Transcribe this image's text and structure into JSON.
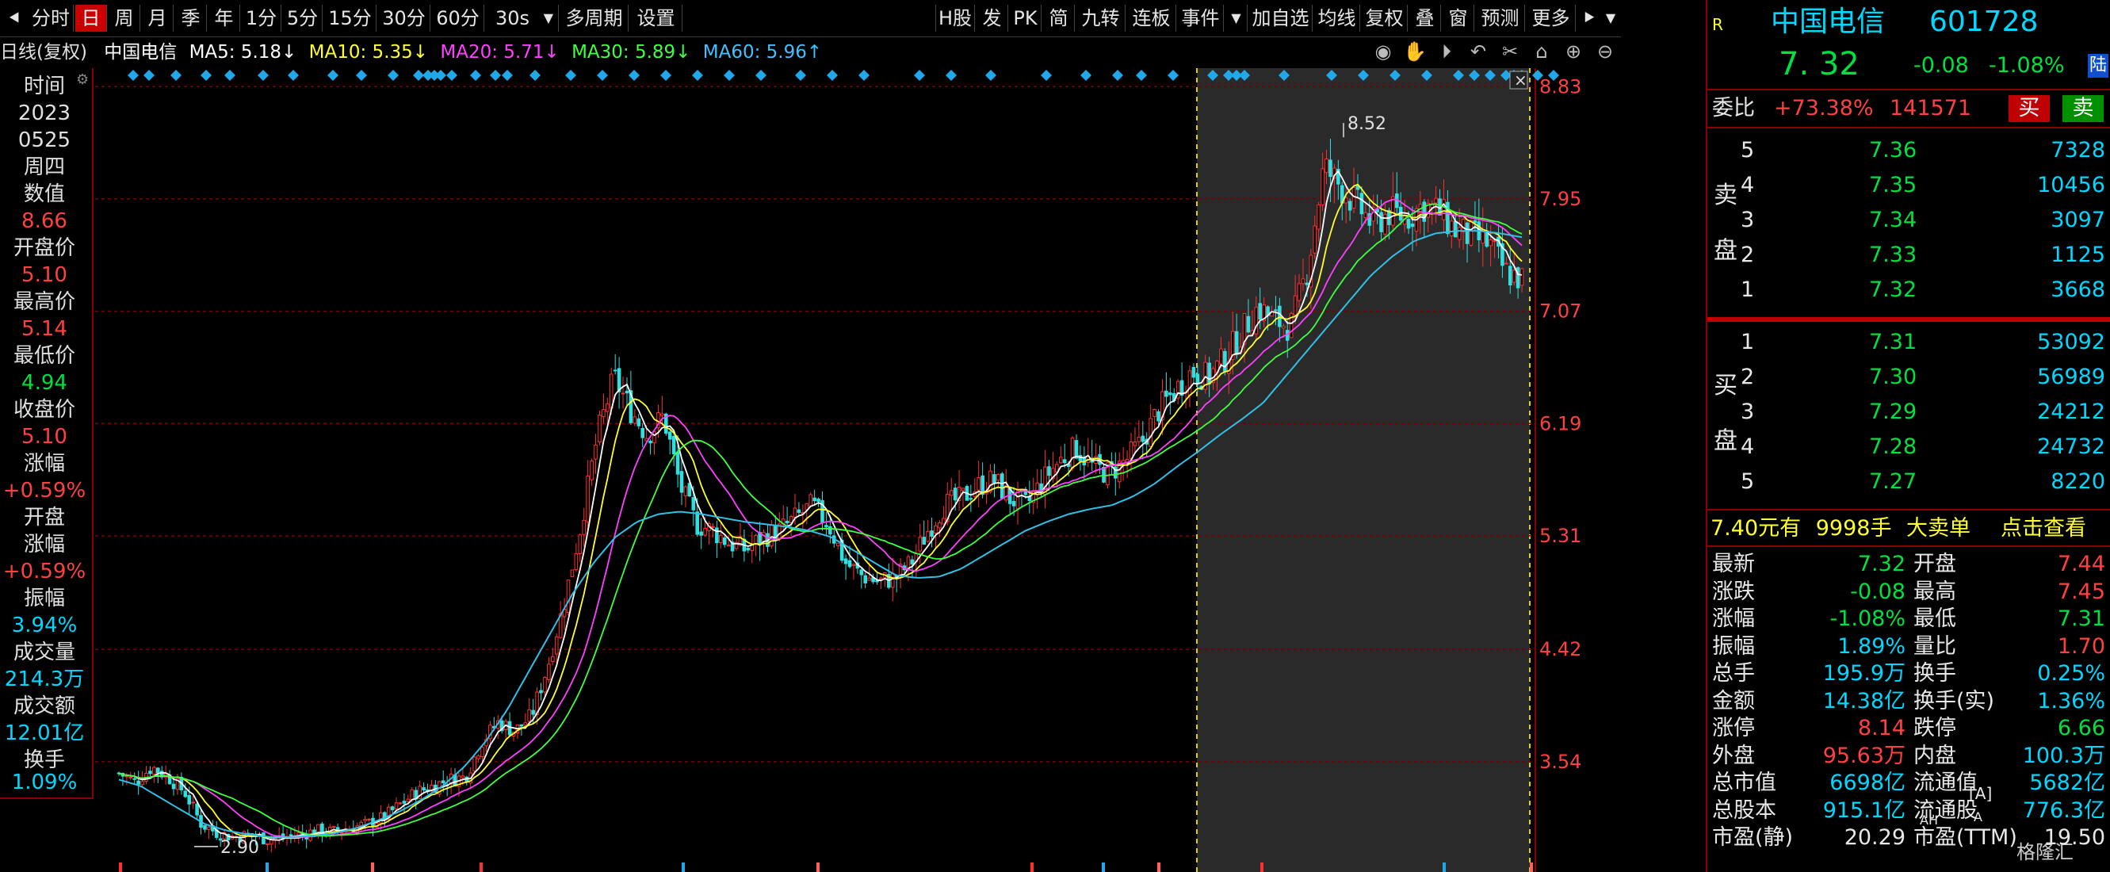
{
  "toolbar": {
    "left": [
      "分时",
      "日",
      "周",
      "月",
      "季",
      "年",
      "1分",
      "5分",
      "15分",
      "30分",
      "60分",
      "30s",
      "多周期",
      "设置"
    ],
    "right": [
      "H股",
      "发",
      "PK",
      "简",
      "九转",
      "连板",
      "事件",
      "加自选",
      "均线",
      "复权",
      "叠",
      "窗",
      "预测",
      "更多"
    ]
  },
  "ma_line": {
    "period": "日线(复权)",
    "name": "中国电信",
    "ma5": "MA5: 5.18↓",
    "ma10": "MA10: 5.35↓",
    "ma20": "MA20: 5.71↓",
    "ma30": "MA30: 5.89↓",
    "ma60": "MA60: 5.96↑"
  },
  "left_panel": [
    {
      "label": "时间",
      "value": "2023",
      "value2": "0525",
      "value3": "周四"
    },
    {
      "label": "数值",
      "value": "8.66"
    },
    {
      "label": "开盘价",
      "value": "5.10"
    },
    {
      "label": "最高价",
      "value": "5.14"
    },
    {
      "label": "最低价",
      "value": "4.94"
    },
    {
      "label": "收盘价",
      "value": "5.10"
    },
    {
      "label": "涨幅",
      "value": "+0.59%"
    },
    {
      "label": "开盘涨幅",
      "value": "+0.59%"
    },
    {
      "label": "振幅",
      "value": "3.94%"
    },
    {
      "label": "成交量",
      "value": "214.3万"
    },
    {
      "label": "成交额",
      "value": "12.01亿"
    },
    {
      "label": "换手",
      "value": "1.09%"
    }
  ],
  "lp_labels": {
    "time": "时间",
    "year": "2023",
    "date": "0525",
    "weekday": "周四",
    "val_label": "数值",
    "val": "8.66",
    "open_label": "开盘价",
    "open": "5.10",
    "high_label": "最高价",
    "high": "5.14",
    "low_label": "最低价",
    "low": "4.94",
    "close_label": "收盘价",
    "close": "5.10",
    "chg_label": "涨幅",
    "chg": "+0.59%",
    "ochg_label1": "开盘",
    "ochg_label2": "涨幅",
    "ochg": "+0.59%",
    "amp_label": "振幅",
    "amp": "3.94%",
    "vol_label": "成交量",
    "vol": "214.3万",
    "amt_label": "成交额",
    "amt": "12.01亿",
    "turn_label": "换手",
    "turn": "1.09%"
  },
  "chart_data": {
    "type": "line",
    "title": "中国电信 日线(复权)",
    "ylim": [
      2.8,
      8.9
    ],
    "yticks": [
      8.83,
      7.95,
      7.07,
      6.19,
      5.31,
      4.42,
      3.54
    ],
    "high_label": "8.52",
    "low_label": "2.90",
    "series": [
      {
        "name": "K线",
        "values": [
          3.45,
          3.38,
          3.5,
          3.42,
          3.3,
          3.05,
          2.98,
          2.95,
          2.97,
          2.93,
          2.95,
          2.97,
          3.0,
          2.99,
          3.02,
          3.05,
          3.1,
          3.2,
          3.3,
          3.35,
          3.4,
          3.42,
          3.7,
          3.85,
          3.78,
          3.9,
          4.3,
          4.8,
          5.4,
          6.1,
          6.55,
          6.3,
          6.1,
          6.25,
          5.7,
          5.4,
          5.35,
          5.25,
          5.2,
          5.3,
          5.35,
          5.45,
          5.55,
          5.4,
          5.1,
          5.0,
          4.95,
          4.98,
          5.1,
          5.35,
          5.55,
          5.6,
          5.7,
          5.75,
          5.6,
          5.55,
          5.75,
          5.9,
          6.0,
          5.85,
          5.8,
          5.9,
          6.05,
          6.3,
          6.45,
          6.6,
          6.55,
          6.7,
          6.9,
          7.1,
          7.0,
          6.95,
          7.4,
          8.2,
          8.05,
          7.9,
          7.75,
          7.85,
          7.8,
          7.9,
          7.85,
          7.7,
          7.65,
          7.6,
          7.38,
          7.32
        ]
      },
      {
        "name": "MA60",
        "values": [
          3.4,
          3.35,
          3.25,
          3.15,
          3.05,
          3.0,
          2.97,
          2.95,
          2.95,
          2.96,
          2.98,
          3.02,
          3.08,
          3.15,
          3.24,
          3.35,
          3.5,
          3.7,
          3.95,
          4.25,
          4.55,
          4.85,
          5.1,
          5.3,
          5.42,
          5.48,
          5.5,
          5.48,
          5.45,
          5.42,
          5.4,
          5.38,
          5.35,
          5.3,
          5.2,
          5.1,
          5.0,
          4.98,
          4.99,
          5.05,
          5.15,
          5.25,
          5.35,
          5.42,
          5.48,
          5.52,
          5.55,
          5.62,
          5.72,
          5.85,
          5.97,
          6.1,
          6.22,
          6.35,
          6.55,
          6.75,
          6.95,
          7.15,
          7.35,
          7.5,
          7.62,
          7.68,
          7.7,
          7.7,
          7.68,
          7.65
        ]
      }
    ],
    "highlight_zone": true
  },
  "right_panel": {
    "badge": "R",
    "name": "中国电信",
    "code": "601728",
    "price": "7. 32",
    "change": "-0.08",
    "pct": "-1.08%",
    "lu": "陆",
    "weibi_label": "委比",
    "weibi": "+73.38%",
    "weicha": "141571",
    "buy_btn": "买",
    "sell_btn": "卖",
    "sell_label1": "卖",
    "sell_label2": "盘",
    "buy_label1": "买",
    "buy_label2": "盘",
    "asks": [
      {
        "lvl": "5",
        "price": "7.36",
        "vol": "7328"
      },
      {
        "lvl": "4",
        "price": "7.35",
        "vol": "10456"
      },
      {
        "lvl": "3",
        "price": "7.34",
        "vol": "3097"
      },
      {
        "lvl": "2",
        "price": "7.33",
        "vol": "1125"
      },
      {
        "lvl": "1",
        "price": "7.32",
        "vol": "3668"
      }
    ],
    "bids": [
      {
        "lvl": "1",
        "price": "7.31",
        "vol": "53092"
      },
      {
        "lvl": "2",
        "price": "7.30",
        "vol": "56989"
      },
      {
        "lvl": "3",
        "price": "7.29",
        "vol": "24212"
      },
      {
        "lvl": "4",
        "price": "7.28",
        "vol": "24732"
      },
      {
        "lvl": "5",
        "price": "7.27",
        "vol": "8220"
      }
    ],
    "bigorder_price": "7.40",
    "bigorder_text1": "元有",
    "bigorder_vol": "9998",
    "bigorder_text2": "手",
    "bigorder_text3": "大卖单",
    "bigorder_link": "点击查看",
    "stats": [
      {
        "l1": "最新",
        "v1": "7.32",
        "l2": "开盘",
        "v2": "7.44"
      },
      {
        "l1": "涨跌",
        "v1": "-0.08",
        "l2": "最高",
        "v2": "7.45"
      },
      {
        "l1": "涨幅",
        "v1": "-1.08%",
        "l2": "最低",
        "v2": "7.31"
      },
      {
        "l1": "振幅",
        "v1": "1.89%",
        "l2": "量比",
        "v2": "1.70"
      },
      {
        "l1": "总手",
        "v1": "195.9万",
        "l2": "换手",
        "v2": "0.25%"
      },
      {
        "l1": "金额",
        "v1": "14.38亿",
        "l2": "换手(实)",
        "v2": "1.36%"
      },
      {
        "l1": "涨停",
        "v1": "8.14",
        "l2": "跌停",
        "v2": "6.66"
      },
      {
        "l1": "外盘",
        "v1": "95.63万",
        "l2": "内盘",
        "v2": "100.3万"
      },
      {
        "l1": "总市值",
        "v1": "6698亿",
        "l2": "流通值",
        "v2": "5682亿"
      },
      {
        "l1": "总股本",
        "v1": "915.1亿",
        "l2": "流通股",
        "v2": "776.3亿"
      },
      {
        "l1": "市盈(静)",
        "v1": "20.29",
        "l2": "市盈(TTM)",
        "v2": "19.50"
      }
    ],
    "tag_a": "[A]",
    "tag_a_small": "A",
    "tag_ah": "AH",
    "watermark": "格隆汇"
  }
}
